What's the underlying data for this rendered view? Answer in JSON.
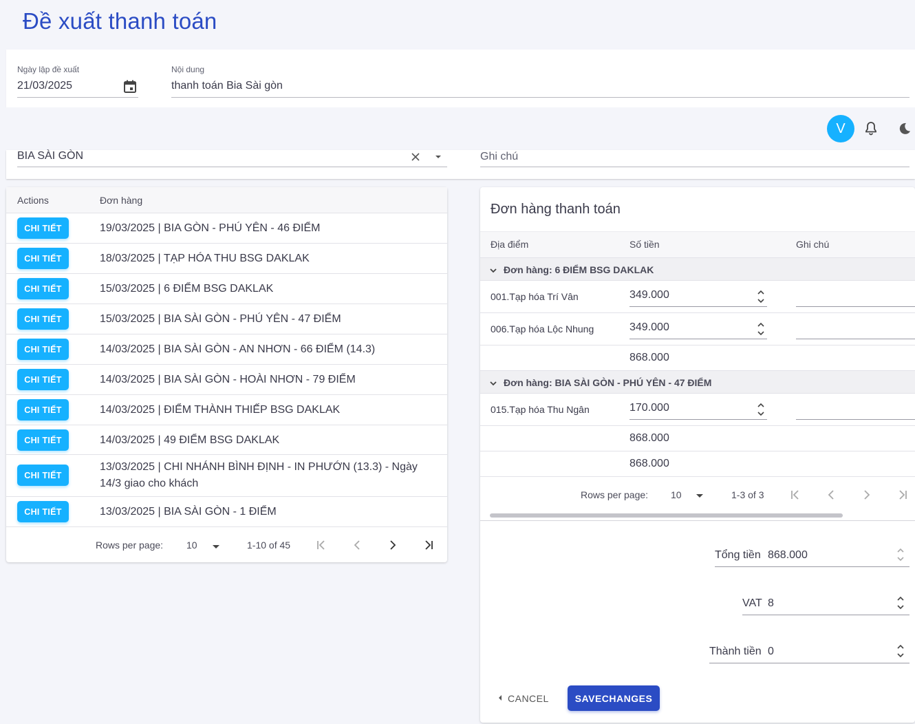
{
  "page": {
    "title": "Đề xuất thanh toán"
  },
  "form": {
    "date_label": "Ngày lập đề xuất",
    "date_value": "21/03/2025",
    "content_label": "Nội dung",
    "content_value": "thanh toán Bia Sài gòn",
    "customer_value": "BIA SÀI GÒN",
    "note_placeholder": "Ghi chú"
  },
  "appbar": {
    "avatar_letter": "V"
  },
  "orders_table": {
    "headers": {
      "actions": "Actions",
      "order": "Đơn hàng"
    },
    "button_label": "CHI TIẾT",
    "rows": [
      "19/03/2025 | BIA GÒN - PHÚ YÊN - 46 ĐIỂM",
      "18/03/2025 | TẠP HÓA THU BSG DAKLAK",
      "15/03/2025 | 6 ĐIỂM BSG DAKLAK",
      "15/03/2025 | BIA SÀI GÒN - PHÚ YÊN - 47 ĐIỂM",
      "14/03/2025 | BIA SÀI GÒN - AN NHƠN - 66 ĐIỂM (14.3)",
      "14/03/2025 | BIA SÀI GÒN - HOÀI NHƠN - 79 ĐIỂM",
      "14/03/2025 | ĐIỂM THÀNH THIẾP BSG DAKLAK",
      "14/03/2025 | 49 ĐIỂM BSG DAKLAK",
      "13/03/2025 | CHI NHÁNH BÌNH ĐỊNH - IN PHƯỚN (13.3) - Ngày 14/3 giao cho khách",
      "13/03/2025 | BIA SÀI GÒN - 1 ĐIỂM"
    ],
    "pager": {
      "rows_per_page_label": "Rows per page:",
      "rows_per_page": "10",
      "range": "1-10 of 45"
    }
  },
  "payment_table": {
    "title": "Đơn hàng thanh toán",
    "headers": {
      "place": "Địa điểm",
      "amount": "Số tiền",
      "note": "Ghi chú"
    },
    "group1": {
      "label": "Đơn hàng: 6 ĐIỂM BSG DAKLAK",
      "rows": [
        {
          "place": "001.Tạp hóa Trí Vân",
          "amount": "349.000"
        },
        {
          "place": "006.Tạp hóa Lộc Nhung",
          "amount": "349.000"
        }
      ],
      "subtotal": "868.000"
    },
    "group2": {
      "label": "Đơn hàng: BIA SÀI GÒN - PHÚ YÊN - 47 ĐIỂM",
      "rows": [
        {
          "place": "015.Tạp hóa Thu Ngân",
          "amount": "170.000"
        }
      ],
      "subtotal": "868.000"
    },
    "total": "868.000",
    "pager": {
      "rows_per_page_label": "Rows per page:",
      "rows_per_page": "10",
      "range": "1-3 of 3"
    }
  },
  "summary": {
    "total_label": "Tổng tiền",
    "total_value": "868.000",
    "vat_label": "VAT",
    "vat_value": "8",
    "final_label": "Thành tiền",
    "final_value": "0"
  },
  "actions": {
    "cancel": "CANCEL",
    "save": "SAVECHANGES"
  },
  "colors": {
    "primary": "#2b4cc4",
    "info": "#16b1ff"
  }
}
